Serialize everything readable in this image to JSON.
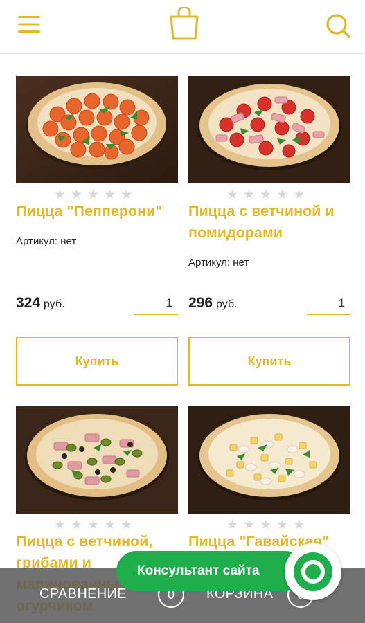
{
  "header": {
    "menu_icon": "hamburger-menu-icon",
    "cart_icon": "shopping-bag-icon",
    "search_icon": "search-icon",
    "accent_color": "#e5b828"
  },
  "products": [
    {
      "title": "Пицца \"Пепперони\"",
      "rating": 0,
      "sku": "Артикул: нет",
      "price": "324",
      "currency": "руб.",
      "quantity": "1",
      "buy_label": "Купить"
    },
    {
      "title": "Пицца с ветчиной и помидорами",
      "rating": 0,
      "sku": "Артикул: нет",
      "price": "296",
      "currency": "руб.",
      "quantity": "1",
      "buy_label": "Купить"
    },
    {
      "title": "Пицца с ветчиной, грибами и маринованным огурчиком",
      "rating": 0
    },
    {
      "title": "Пицца \"Гавайская\"",
      "rating": 0
    }
  ],
  "bottom_bar": {
    "compare_label": "СРАВНЕНИЕ",
    "compare_count": "0",
    "basket_label": "КОРЗИНА",
    "basket_count": "0"
  },
  "consultant": {
    "label": "Консультант сайта",
    "color": "#1fae4b"
  }
}
